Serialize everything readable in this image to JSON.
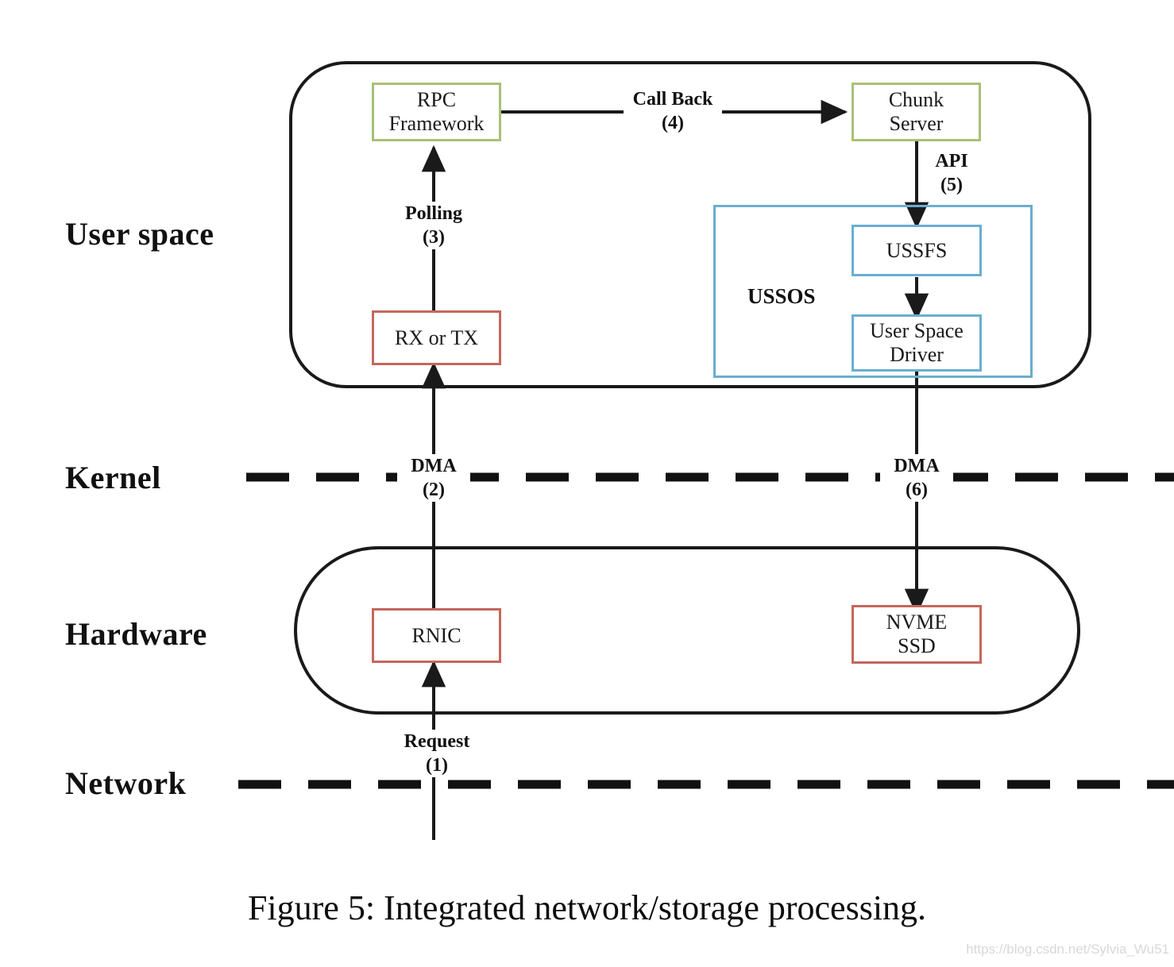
{
  "figure": {
    "caption": "Figure 5: Integrated network/storage processing.",
    "watermark": "https://blog.csdn.net/Sylvia_Wu51"
  },
  "colors": {
    "green_border": "#a8c077",
    "red_border": "#c4675d",
    "blue_border": "#6aaed0",
    "line": "#1a1a1a",
    "background": "#ffffff"
  },
  "layers": [
    {
      "id": "user-space",
      "label": "User space"
    },
    {
      "id": "kernel",
      "label": "Kernel"
    },
    {
      "id": "hardware",
      "label": "Hardware"
    },
    {
      "id": "network",
      "label": "Network"
    }
  ],
  "groups": [
    {
      "id": "ussos",
      "label": "USSOS",
      "border": "blue"
    }
  ],
  "nodes": [
    {
      "id": "rpc-framework",
      "label": "RPC\nFramework",
      "line1": "RPC",
      "line2": "Framework",
      "border": "green",
      "layer": "user-space"
    },
    {
      "id": "chunk-server",
      "label": "Chunk\nServer",
      "line1": "Chunk",
      "line2": "Server",
      "border": "green",
      "layer": "user-space"
    },
    {
      "id": "rx-or-tx",
      "label": "RX or TX",
      "line1": "RX or TX",
      "line2": "",
      "border": "red",
      "layer": "user-space"
    },
    {
      "id": "ussfs",
      "label": "USSFS",
      "line1": "USSFS",
      "line2": "",
      "border": "blue",
      "layer": "user-space"
    },
    {
      "id": "user-space-driver",
      "label": "User Space\nDriver",
      "line1": "User Space",
      "line2": "Driver",
      "border": "blue",
      "layer": "user-space"
    },
    {
      "id": "rnic",
      "label": "RNIC",
      "line1": "RNIC",
      "line2": "",
      "border": "red",
      "layer": "hardware"
    },
    {
      "id": "nvme-ssd",
      "label": "NVME\nSSD",
      "line1": "NVME",
      "line2": "SSD",
      "border": "red",
      "layer": "hardware"
    }
  ],
  "edges": [
    {
      "id": "request",
      "name": "Request",
      "step": "(1)",
      "from": "network",
      "to": "rnic"
    },
    {
      "id": "dma-2",
      "name": "DMA",
      "step": "(2)",
      "from": "rnic",
      "to": "rx-or-tx"
    },
    {
      "id": "polling",
      "name": "Polling",
      "step": "(3)",
      "from": "rx-or-tx",
      "to": "rpc-framework"
    },
    {
      "id": "call-back",
      "name": "Call Back",
      "step": "(4)",
      "from": "rpc-framework",
      "to": "chunk-server"
    },
    {
      "id": "api",
      "name": "API",
      "step": "(5)",
      "from": "chunk-server",
      "to": "ussfs"
    },
    {
      "id": "ussfs-usd",
      "name": "",
      "step": "",
      "from": "ussfs",
      "to": "user-space-driver"
    },
    {
      "id": "dma-6",
      "name": "DMA",
      "step": "(6)",
      "from": "user-space-driver",
      "to": "nvme-ssd"
    }
  ]
}
